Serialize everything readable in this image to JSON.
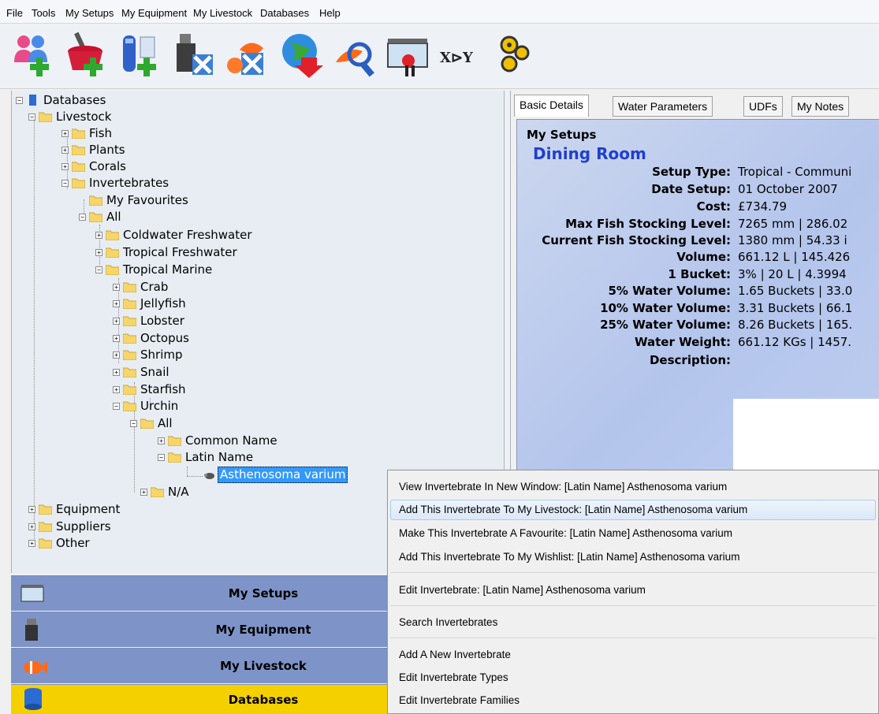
{
  "menubar": [
    "File",
    "Tools",
    "My Setups",
    "My Equipment",
    "My Livestock",
    "Databases",
    "Help"
  ],
  "toolbar": {
    "buttons": [
      "add-users-icon",
      "add-tank-icon",
      "add-test-icon",
      "add-equipment-icon",
      "delete-equipment-icon",
      "fish-delete-icon",
      "globe-download-icon",
      "fish-search-icon",
      "tank-tools-icon",
      "xy-graph-icon",
      "settings-gears-icon"
    ],
    "xy_label": "X⊳Y"
  },
  "tree": {
    "databases": "Databases",
    "livestock": "Livestock",
    "fish": "Fish",
    "plants": "Plants",
    "corals": "Corals",
    "invertebrates": "Invertebrates",
    "my_favourites": "My Favourites",
    "all": "All",
    "coldwater_freshwater": "Coldwater Freshwater",
    "tropical_freshwater": "Tropical Freshwater",
    "tropical_marine": "Tropical Marine",
    "crab": "Crab",
    "jellyfish": "Jellyfish",
    "lobster": "Lobster",
    "octopus": "Octopus",
    "shrimp": "Shrimp",
    "snail": "Snail",
    "starfish": "Starfish",
    "urchin": "Urchin",
    "urchin_all": "All",
    "common_name": "Common Name",
    "latin_name": "Latin Name",
    "selected_item": "Asthenosoma varium",
    "na": "N/A",
    "equipment": "Equipment",
    "suppliers": "Suppliers",
    "other": "Other"
  },
  "nav": {
    "my_setups": "My Setups",
    "my_equipment": "My Equipment",
    "my_livestock": "My Livestock",
    "databases": "Databases",
    "active_color": "#f5d000",
    "inactive_color": "#7e94c8"
  },
  "tabs": [
    "Basic Details",
    "Water Parameters",
    "UDFs",
    "My Notes"
  ],
  "details": {
    "section": "My Setups",
    "setup_name": "Dining Room",
    "rows": [
      {
        "key": "Setup Type:",
        "value": "Tropical - Communi"
      },
      {
        "key": "Date Setup:",
        "value": "01 October 2007"
      },
      {
        "key": "Cost:",
        "value": "£734.79"
      },
      {
        "key": "Max Fish Stocking Level:",
        "value": "7265 mm | 286.02"
      },
      {
        "key": "Current Fish Stocking Level:",
        "value": "1380 mm | 54.33 i"
      },
      {
        "key": "Volume:",
        "value": "661.12 L | 145.426"
      },
      {
        "key": "1 Bucket:",
        "value": "3% | 20 L | 4.3994"
      },
      {
        "key": "5% Water Volume:",
        "value": "1.65 Buckets | 33.0"
      },
      {
        "key": "10% Water Volume:",
        "value": "3.31 Buckets | 66.1"
      },
      {
        "key": "25% Water Volume:",
        "value": "8.26 Buckets | 165."
      },
      {
        "key": "Water Weight:",
        "value": "661.12 KGs | 1457."
      },
      {
        "key": "Description:",
        "value": ""
      }
    ]
  },
  "context_menu": {
    "items": [
      "View Invertebrate In New Window: [Latin Name] Asthenosoma varium",
      "Add This Invertebrate To My Livestock: [Latin Name] Asthenosoma varium",
      "Make This Invertebrate A Favourite: [Latin Name] Asthenosoma varium",
      "Add This Invertebrate To My Wishlist: [Latin Name] Asthenosoma varium",
      "Edit Invertebrate: [Latin Name] Asthenosoma varium",
      "Search Invertebrates",
      "Add A New Invertebrate",
      "Edit Invertebrate Types",
      "Edit Invertebrate Families"
    ]
  }
}
